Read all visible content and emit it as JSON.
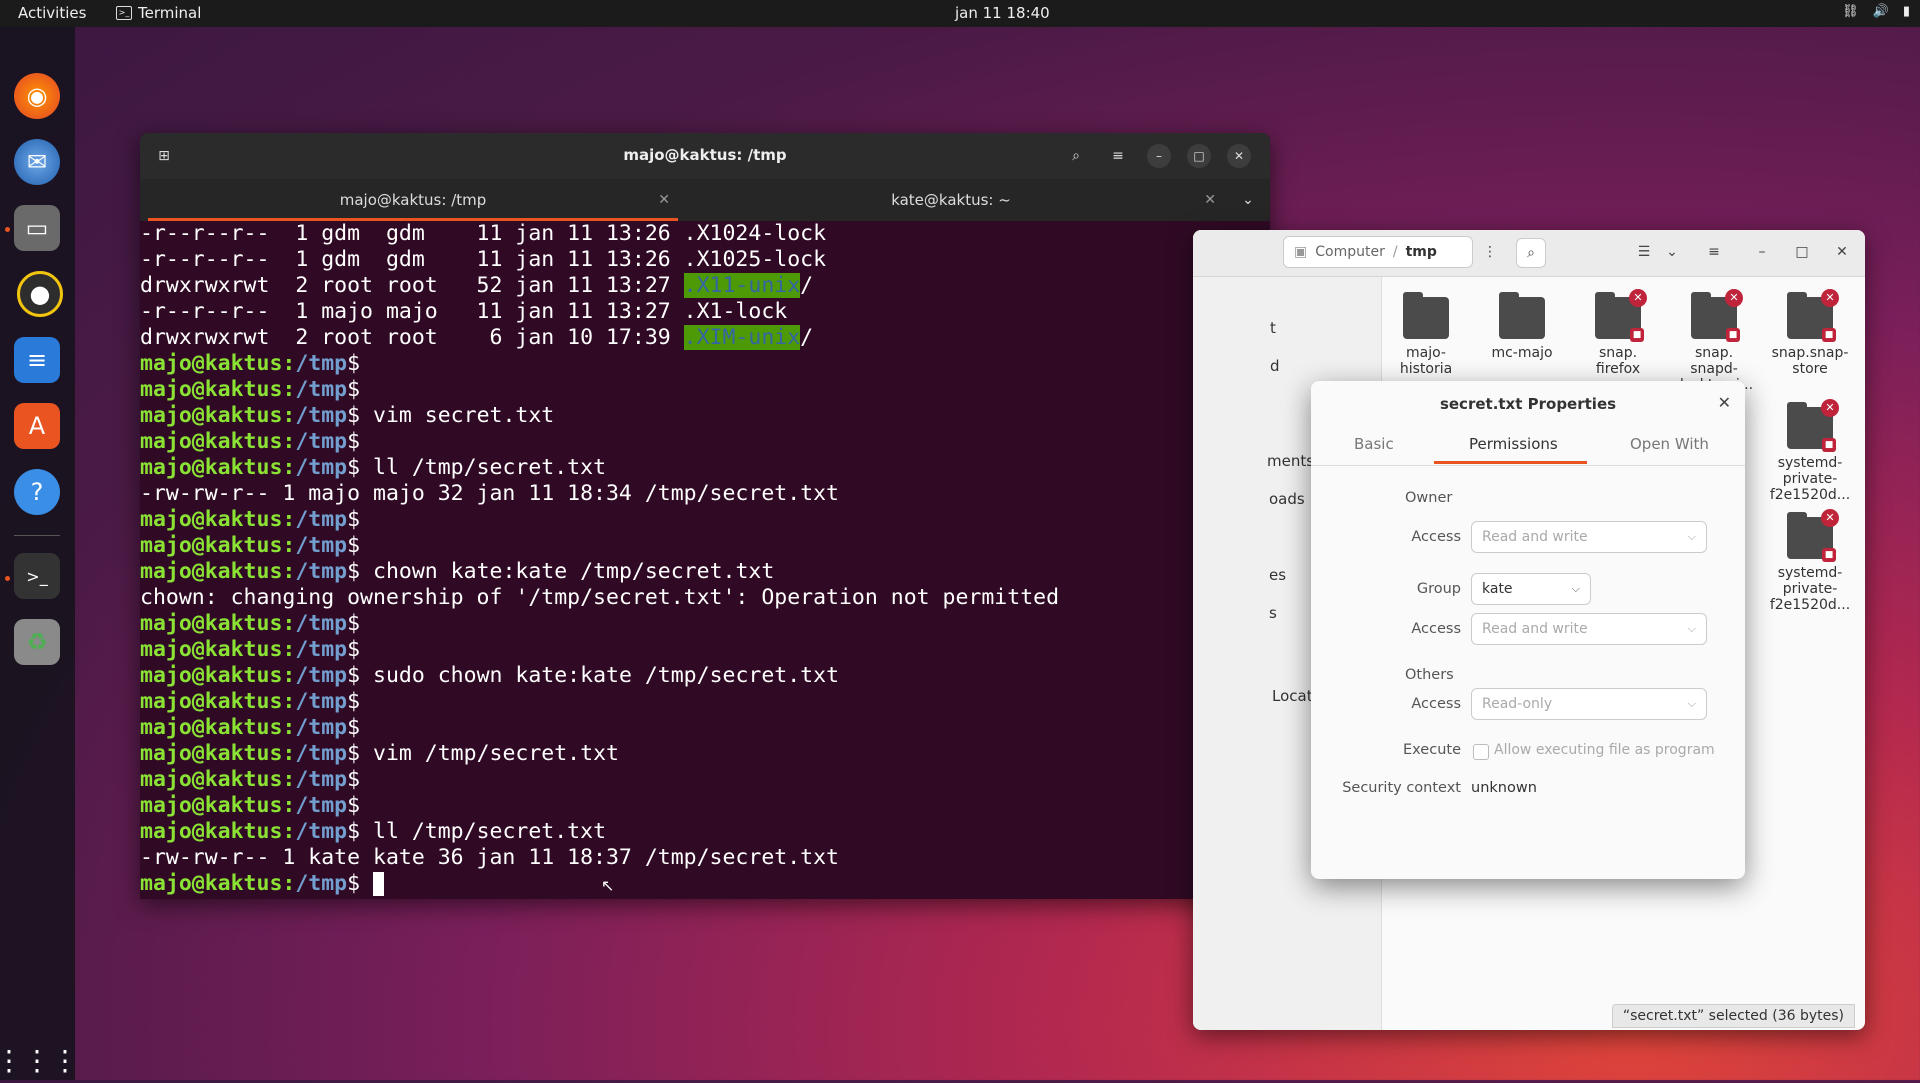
{
  "topbar": {
    "activities": "Activities",
    "app_name": "Terminal",
    "clock": "jan 11  18:40"
  },
  "terminal": {
    "title": "majo@kaktus: /tmp",
    "tabs": [
      {
        "label": "majo@kaktus: /tmp",
        "active": true
      },
      {
        "label": "kate@kaktus: ~",
        "active": false
      }
    ],
    "prompt_user": "majo@kaktus",
    "prompt_path": "/tmp",
    "lines": [
      {
        "kind": "text",
        "text": "-r--r--r--  1 gdm  gdm    11 jan 11 13:26 .X1024-lock"
      },
      {
        "kind": "text",
        "text": "-r--r--r--  1 gdm  gdm    11 jan 11 13:26 .X1025-lock"
      },
      {
        "kind": "hl",
        "pre": "drwxrwxrwt  2 root root   52 jan 11 13:27 ",
        "hl": ".X11-unix",
        "post": "/"
      },
      {
        "kind": "text",
        "text": "-r--r--r--  1 majo majo   11 jan 11 13:27 .X1-lock"
      },
      {
        "kind": "hl",
        "pre": "drwxrwxrwt  2 root root    6 jan 10 17:39 ",
        "hl": ".XIM-unix",
        "post": "/"
      },
      {
        "kind": "prompt",
        "cmd": ""
      },
      {
        "kind": "prompt",
        "cmd": ""
      },
      {
        "kind": "prompt",
        "cmd": " vim secret.txt"
      },
      {
        "kind": "prompt",
        "cmd": ""
      },
      {
        "kind": "prompt",
        "cmd": " ll /tmp/secret.txt"
      },
      {
        "kind": "text",
        "text": "-rw-rw-r-- 1 majo majo 32 jan 11 18:34 /tmp/secret.txt"
      },
      {
        "kind": "prompt",
        "cmd": ""
      },
      {
        "kind": "prompt",
        "cmd": ""
      },
      {
        "kind": "prompt",
        "cmd": " chown kate:kate /tmp/secret.txt"
      },
      {
        "kind": "text",
        "text": "chown: changing ownership of '/tmp/secret.txt': Operation not permitted"
      },
      {
        "kind": "prompt",
        "cmd": ""
      },
      {
        "kind": "prompt",
        "cmd": ""
      },
      {
        "kind": "prompt",
        "cmd": " sudo chown kate:kate /tmp/secret.txt"
      },
      {
        "kind": "prompt",
        "cmd": ""
      },
      {
        "kind": "prompt",
        "cmd": ""
      },
      {
        "kind": "prompt",
        "cmd": " vim /tmp/secret.txt"
      },
      {
        "kind": "prompt",
        "cmd": ""
      },
      {
        "kind": "prompt",
        "cmd": ""
      },
      {
        "kind": "prompt",
        "cmd": " ll /tmp/secret.txt"
      },
      {
        "kind": "text",
        "text": "-rw-rw-r-- 1 kate kate 36 jan 11 18:37 /tmp/secret.txt"
      },
      {
        "kind": "prompt",
        "cmd": " ",
        "cursor": true
      }
    ]
  },
  "files": {
    "path_root": "Computer",
    "path_current": "tmp",
    "sidebar_fragments": [
      "t",
      "d",
      "ments",
      "oads",
      "es",
      "s",
      "Locat"
    ],
    "items": [
      {
        "name": "majo-\nhistoria",
        "locked": false
      },
      {
        "name": "mc-majo",
        "locked": false
      },
      {
        "name": "snap.\nfirefox",
        "locked": true
      },
      {
        "name": "snap.\nsnapd-\ndesktop-i...",
        "locked": true
      },
      {
        "name": "snap.snap-\nstore",
        "locked": true
      },
      {
        "name": "systemd-\nprivate-\nf2e1520d...",
        "locked": true
      },
      {
        "name": "systemd-\nprivate-\nf2e1520d...",
        "locked": true
      }
    ],
    "status": "“secret.txt” selected  (36 bytes)"
  },
  "properties": {
    "title": "secret.txt Properties",
    "tabs": [
      "Basic",
      "Permissions",
      "Open With"
    ],
    "active_tab": "Permissions",
    "owner_label": "Owner",
    "access_label": "Access",
    "owner_access": "Read and write",
    "group_label": "Group",
    "group_value": "kate",
    "group_access": "Read and write",
    "others_label": "Others",
    "others_access": "Read-only",
    "execute_label": "Execute",
    "execute_text": "Allow executing file as program",
    "security_label": "Security context",
    "security_value": "unknown"
  },
  "colors": {
    "accent": "#e95420",
    "prompt_user": "#8ae234",
    "prompt_path": "#729fcf",
    "terminal_bg": "#300a24"
  }
}
